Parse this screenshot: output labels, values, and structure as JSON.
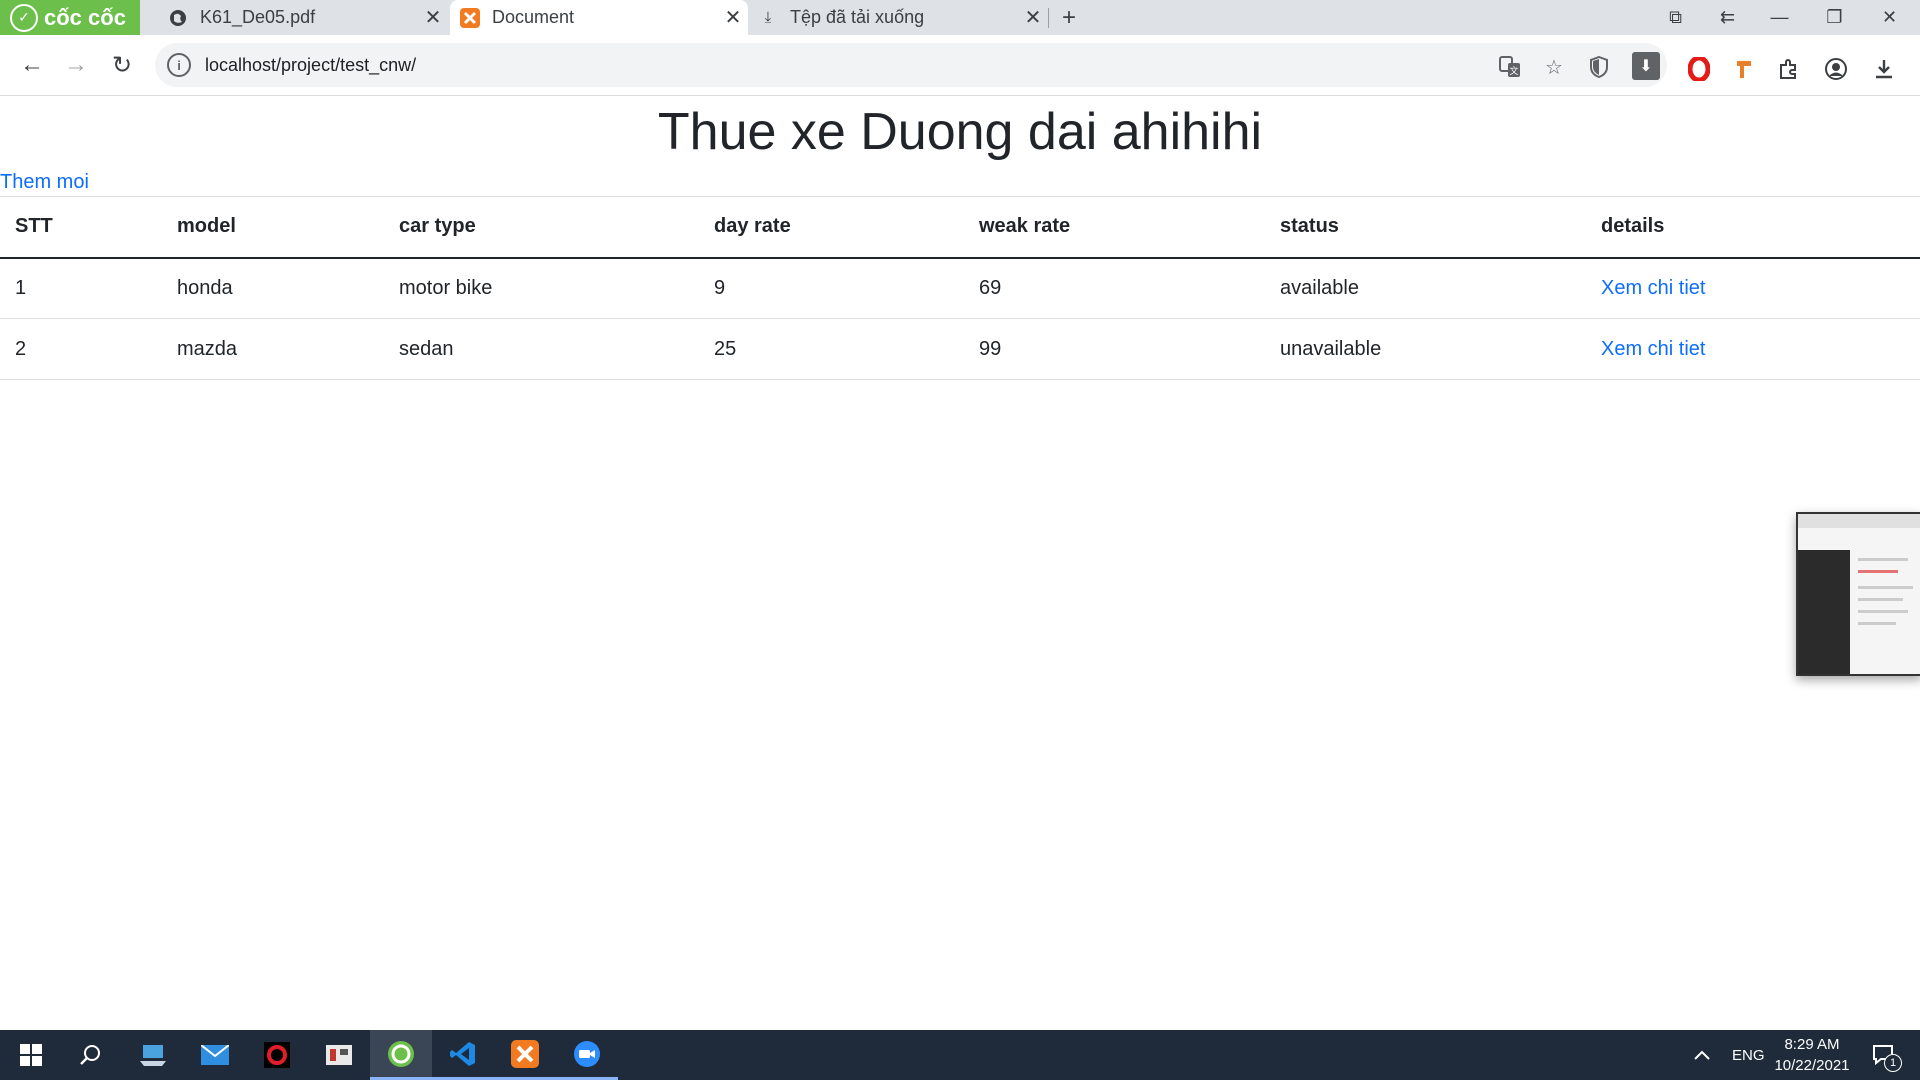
{
  "browser": {
    "brand": "cốc cốc",
    "tabs": [
      {
        "label": "K61_De05.pdf",
        "icon": "globe-icon",
        "active": false
      },
      {
        "label": "Document",
        "icon": "xampp-icon",
        "active": true
      },
      {
        "label": "Tệp đã tải xuống",
        "icon": "download-icon",
        "active": false
      }
    ],
    "address": "localhost/project/test_cnw/"
  },
  "page": {
    "title": "Thue xe Duong dai ahihihi",
    "add_link": "Them moi",
    "columns": [
      "STT",
      "model",
      "car type",
      "day rate",
      "weak rate",
      "status",
      "details"
    ],
    "rows": [
      {
        "stt": "1",
        "model": "honda",
        "car_type": "motor bike",
        "day_rate": "9",
        "weak_rate": "69",
        "status": "available",
        "details": "Xem chi tiet"
      },
      {
        "stt": "2",
        "model": "mazda",
        "car_type": "sedan",
        "day_rate": "25",
        "weak_rate": "99",
        "status": "unavailable",
        "details": "Xem chi tiet"
      }
    ]
  },
  "taskbar": {
    "language": "ENG",
    "time": "8:29 AM",
    "date": "10/22/2021",
    "notifications": "1"
  },
  "colors": {
    "brand_green": "#6cbf4a",
    "link_blue": "#0d6efd",
    "taskbar": "#1f2b3a"
  }
}
